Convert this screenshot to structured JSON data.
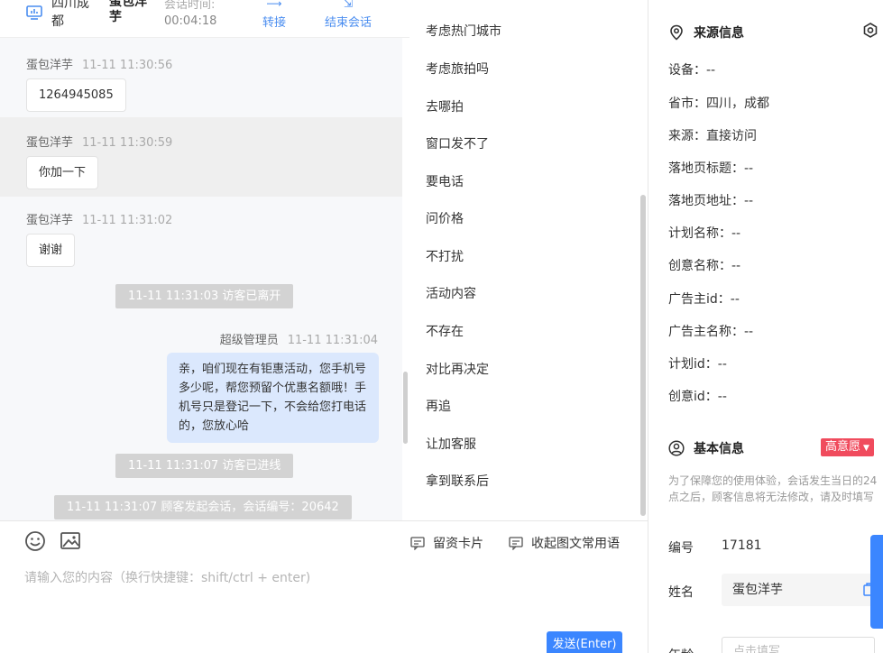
{
  "header": {
    "location": "四川成都",
    "visitor_name": "蛋包洋芋",
    "duration_label": "会话时间:",
    "duration": "00:04:18",
    "transfer_label": "转接",
    "end_label": "结束会话"
  },
  "messages": [
    {
      "sender": "蛋包洋芋",
      "time": "11-11 11:30:56",
      "text": "1264945085"
    },
    {
      "sender": "蛋包洋芋",
      "time": "11-11 11:30:59",
      "text": "你加一下"
    },
    {
      "sender": "蛋包洋芋",
      "time": "11-11 11:31:02",
      "text": "谢谢"
    }
  ],
  "system": {
    "left": "11-11 11:31:03 访客已离开",
    "entered": "11-11 11:31:07 访客已进线",
    "started": "11-11 11:31:07 顾客发起会话，会话编号：20642"
  },
  "agent_message": {
    "sender": "超级管理员",
    "time": "11-11 11:31:04",
    "text": "亲，咱们现在有钜惠活动，您手机号多少呢，帮您预留个优惠名额哦！手机号只是登记一下，不会给您打电话的，您放心哈"
  },
  "composer": {
    "card_label": "留资卡片",
    "phrases_label": "收起图文常用语",
    "placeholder": "请输入您的内容（换行快捷键：shift/ctrl + enter)",
    "send_label": "发送(Enter)"
  },
  "phrases": [
    "考虑热门城市",
    "考虑旅拍吗",
    "去哪拍",
    "窗口发不了",
    "要电话",
    "问价格",
    "不打扰",
    "活动内容",
    "不存在",
    "对比再决定",
    "再追",
    "让加客服",
    "拿到联系后"
  ],
  "source_info": {
    "title": "来源信息",
    "fields": [
      "设备：--",
      "省市：四川，成都",
      "来源：直接访问",
      "落地页标题：--",
      "落地页地址：--",
      "计划名称：--",
      "创意名称：--",
      "广告主id：--",
      "广告主名称：--",
      "计划id：--",
      "创意id：--"
    ]
  },
  "basic_info": {
    "title": "基本信息",
    "intent_badge": "高意愿",
    "note": "为了保障您的使用体验，会话发生当日的24点之后，顾客信息将无法修改，请及时填写",
    "id_label": "编号",
    "id_value": "17181",
    "name_label": "姓名",
    "name_value": "蛋包洋芋",
    "age_label": "年龄",
    "age_placeholder": "点击填写"
  },
  "colors": {
    "accent": "#3b86ff",
    "badge": "#f04b5d",
    "agent_bubble": "#dbe8fd",
    "system_pill": "#d3d3d3"
  }
}
